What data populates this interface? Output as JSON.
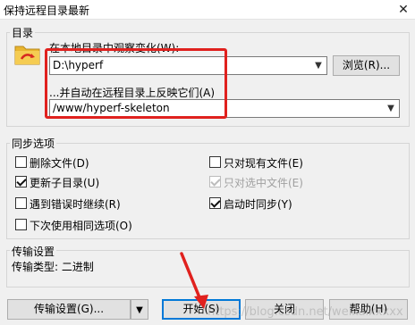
{
  "window": {
    "title": "保持远程目录最新",
    "close_glyph": "✕"
  },
  "directories": {
    "group_label": "目录",
    "local_label": "在本地目录中观察变化(W):",
    "local_value": "D:\\hyperf",
    "browse_label": "浏览(R)...",
    "remote_label": "...并自动在远程目录上反映它们(A)",
    "remote_value": "/www/hyperf-skeleton"
  },
  "sync_options": {
    "group_label": "同步选项",
    "items": [
      {
        "label": "删除文件(D)",
        "checked": false,
        "enabled": true
      },
      {
        "label": "只对现有文件(E)",
        "checked": false,
        "enabled": true
      },
      {
        "label": "更新子目录(U)",
        "checked": true,
        "enabled": true
      },
      {
        "label": "只对选中文件(E)",
        "checked": true,
        "enabled": false
      },
      {
        "label": "遇到错误时继续(R)",
        "checked": false,
        "enabled": true
      },
      {
        "label": "启动时同步(Y)",
        "checked": true,
        "enabled": true
      },
      {
        "label": "下次使用相同选项(O)",
        "checked": false,
        "enabled": true
      }
    ]
  },
  "transfer": {
    "group_label": "传输设置",
    "type_text": "传输类型: 二进制"
  },
  "buttons": {
    "transfer_settings": "传输设置(G)...",
    "start": "开始(S)",
    "close": "关闭",
    "help": "帮助(H)"
  },
  "watermark": "https://blog.csdn.net/weikaixxxxx",
  "colors": {
    "highlight": "#e0211e",
    "default_button_border": "#0078d7"
  }
}
